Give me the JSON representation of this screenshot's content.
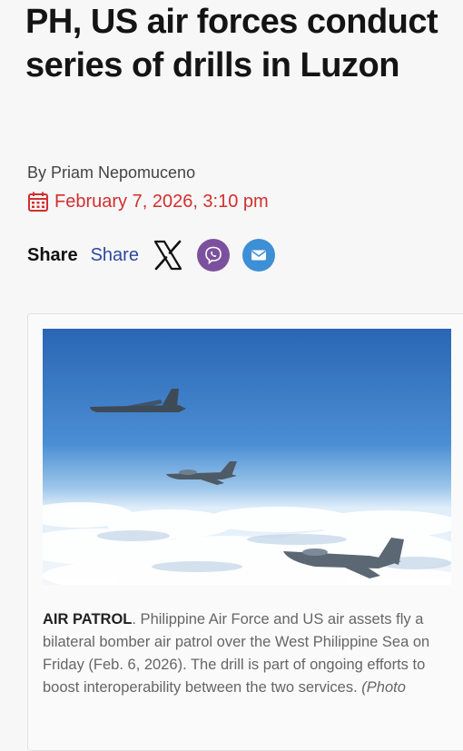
{
  "article": {
    "headline": "PH, US air forces conduct series of drills in Luzon",
    "byline": "By Priam Nepomuceno",
    "date": "February 7, 2026, 3:10 pm"
  },
  "share": {
    "label": "Share",
    "link_label": "Share",
    "buttons": [
      {
        "icon": "x-icon"
      },
      {
        "icon": "viber-icon",
        "color": "#7b519d"
      },
      {
        "icon": "mail-icon",
        "color": "#3d8fd6"
      }
    ]
  },
  "photo": {
    "caption_lead": "AIR PATROL",
    "caption_body": ". Philippine Air Force and US air assets fly a bilateral bomber air patrol over the West Philippine Sea on Friday (Feb. 6, 2026). The drill is part of ongoing efforts to boost interoperability between the two services. ",
    "caption_credit": "(Photo"
  },
  "colors": {
    "date_red": "#d32f2f",
    "share_blue": "#2a4a9e"
  }
}
